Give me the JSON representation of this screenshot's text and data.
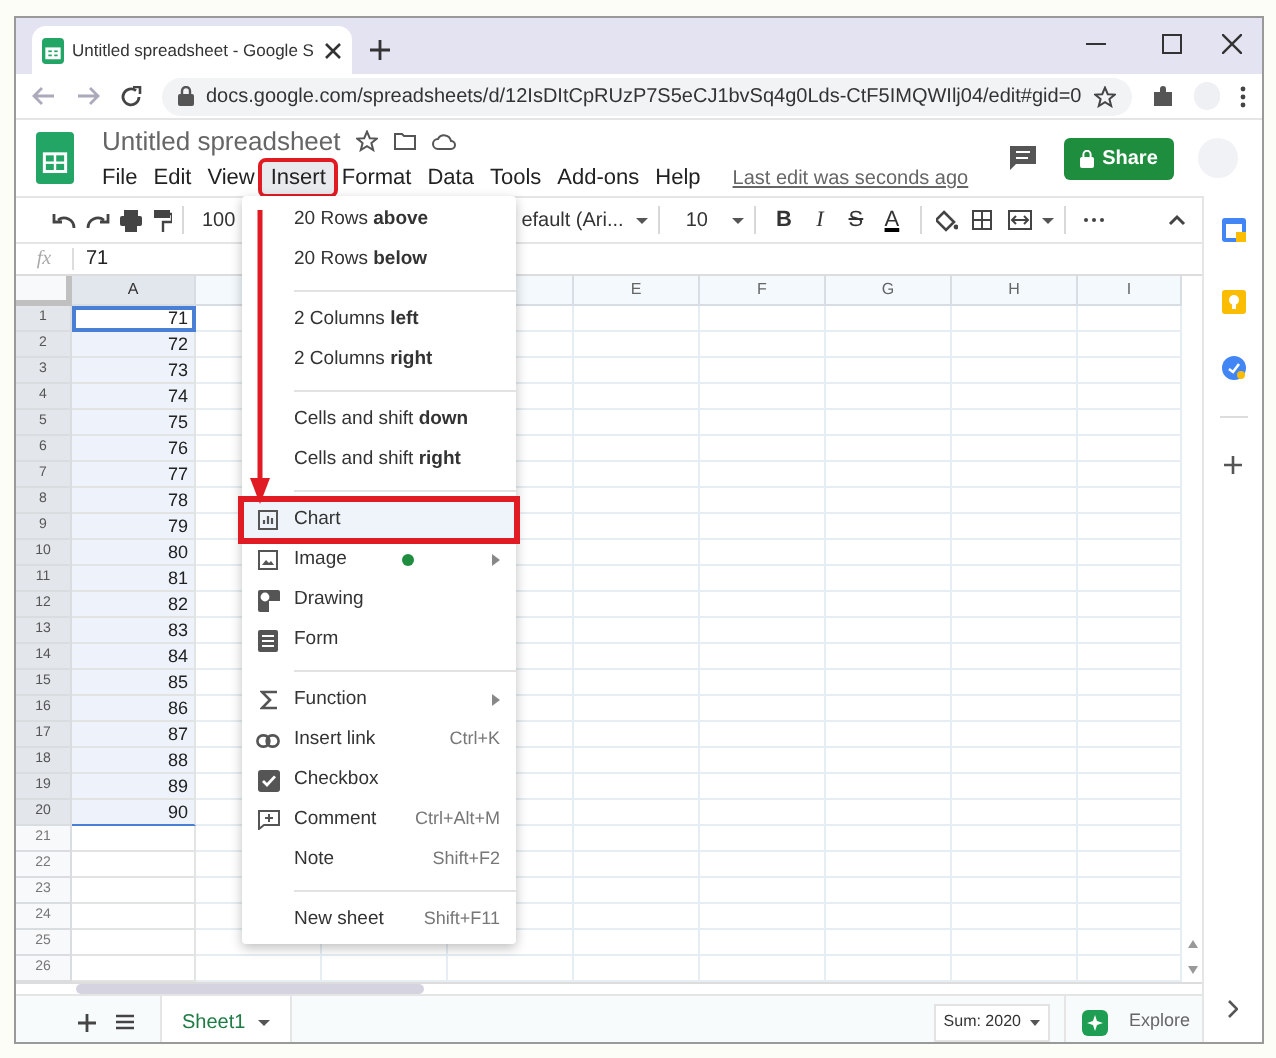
{
  "browser": {
    "tab_title": "Untitled spreadsheet - Google S",
    "url": "docs.google.com/spreadsheets/d/12IsDItCpRUzP7S5eCJ1bvSq4g0Lds-CtF5IMQWIlj04/edit#gid=0"
  },
  "doc": {
    "title": "Untitled spreadsheet",
    "last_edit": "Last edit was seconds ago",
    "share_label": "Share"
  },
  "menu_bar": [
    {
      "label": "File",
      "selected": false,
      "highlighted": false
    },
    {
      "label": "Edit",
      "selected": false,
      "highlighted": false
    },
    {
      "label": "View",
      "selected": false,
      "highlighted": false
    },
    {
      "label": "Insert",
      "selected": true,
      "highlighted": true
    },
    {
      "label": "Format",
      "selected": false,
      "highlighted": false
    },
    {
      "label": "Data",
      "selected": false,
      "highlighted": false
    },
    {
      "label": "Tools",
      "selected": false,
      "highlighted": false
    },
    {
      "label": "Add-ons",
      "selected": false,
      "highlighted": false
    },
    {
      "label": "Help",
      "selected": false,
      "highlighted": false
    }
  ],
  "toolbar": {
    "zoom": "100",
    "font": "efault (Ari...",
    "font_size": "10",
    "format_buttons": [
      "B",
      "I",
      "S",
      "A"
    ]
  },
  "formula_bar": {
    "fx": "fx",
    "value": "71"
  },
  "columns": [
    {
      "label": "A",
      "selected": true
    },
    {
      "label": "E",
      "selected": false
    },
    {
      "label": "F",
      "selected": false
    },
    {
      "label": "G",
      "selected": false
    },
    {
      "label": "H",
      "selected": false
    },
    {
      "label": "I",
      "selected": false
    }
  ],
  "rows": [
    {
      "label": "1",
      "value": "71",
      "selected": true,
      "active": true
    },
    {
      "label": "2",
      "value": "72",
      "selected": true,
      "active": false
    },
    {
      "label": "3",
      "value": "73",
      "selected": true,
      "active": false
    },
    {
      "label": "4",
      "value": "74",
      "selected": true,
      "active": false
    },
    {
      "label": "5",
      "value": "75",
      "selected": true,
      "active": false
    },
    {
      "label": "6",
      "value": "76",
      "selected": true,
      "active": false
    },
    {
      "label": "7",
      "value": "77",
      "selected": true,
      "active": false
    },
    {
      "label": "8",
      "value": "78",
      "selected": true,
      "active": false
    },
    {
      "label": "9",
      "value": "79",
      "selected": true,
      "active": false
    },
    {
      "label": "10",
      "value": "80",
      "selected": true,
      "active": false
    },
    {
      "label": "11",
      "value": "81",
      "selected": true,
      "active": false
    },
    {
      "label": "12",
      "value": "82",
      "selected": true,
      "active": false
    },
    {
      "label": "13",
      "value": "83",
      "selected": true,
      "active": false
    },
    {
      "label": "14",
      "value": "84",
      "selected": true,
      "active": false
    },
    {
      "label": "15",
      "value": "85",
      "selected": true,
      "active": false
    },
    {
      "label": "16",
      "value": "86",
      "selected": true,
      "active": false
    },
    {
      "label": "17",
      "value": "87",
      "selected": true,
      "active": false
    },
    {
      "label": "18",
      "value": "88",
      "selected": true,
      "active": false
    },
    {
      "label": "19",
      "value": "89",
      "selected": true,
      "active": false
    },
    {
      "label": "20",
      "value": "90",
      "selected": true,
      "active": false
    },
    {
      "label": "21",
      "selected": false,
      "active": false
    },
    {
      "label": "22",
      "selected": false,
      "active": false
    },
    {
      "label": "23",
      "selected": false,
      "active": false
    },
    {
      "label": "24",
      "selected": false,
      "active": false
    },
    {
      "label": "25",
      "selected": false,
      "active": false
    },
    {
      "label": "26",
      "selected": false,
      "active": false
    }
  ],
  "insert_menu": [
    {
      "kind": "text",
      "label": "20 Rows **above**",
      "highlighted": false,
      "submenu": false,
      "dot": false
    },
    {
      "kind": "text",
      "label": "20 Rows **below**",
      "highlighted": false,
      "submenu": false,
      "dot": false
    },
    {
      "kind": "divider"
    },
    {
      "kind": "text",
      "label": "2 Columns **left**",
      "highlighted": false,
      "submenu": false,
      "dot": false
    },
    {
      "kind": "text",
      "label": "2 Columns **right**",
      "highlighted": false,
      "submenu": false,
      "dot": false
    },
    {
      "kind": "divider"
    },
    {
      "kind": "text",
      "label": "Cells and shift **down**",
      "highlighted": false,
      "submenu": false,
      "dot": false
    },
    {
      "kind": "text",
      "label": "Cells and shift **right**",
      "highlighted": false,
      "submenu": false,
      "dot": false
    },
    {
      "kind": "divider"
    },
    {
      "kind": "chart",
      "label": "Chart",
      "highlighted": true,
      "submenu": false,
      "dot": false
    },
    {
      "kind": "image",
      "label": "Image",
      "highlighted": false,
      "submenu": true,
      "dot": true
    },
    {
      "kind": "drawing",
      "label": "Drawing",
      "highlighted": false,
      "submenu": false,
      "dot": false
    },
    {
      "kind": "form",
      "label": "Form",
      "highlighted": false,
      "submenu": false,
      "dot": false
    },
    {
      "kind": "divider"
    },
    {
      "kind": "function",
      "label": "Function",
      "highlighted": false,
      "submenu": true,
      "dot": false
    },
    {
      "kind": "link",
      "label": "Insert link",
      "shortcut": "Ctrl+K",
      "highlighted": false,
      "submenu": false,
      "dot": false
    },
    {
      "kind": "checkbox",
      "label": "Checkbox",
      "highlighted": false,
      "submenu": false,
      "dot": false
    },
    {
      "kind": "comment",
      "label": "Comment",
      "shortcut": "Ctrl+Alt+M",
      "highlighted": false,
      "submenu": false,
      "dot": false
    },
    {
      "kind": "text",
      "label": "Note",
      "shortcut": "Shift+F2",
      "highlighted": false,
      "submenu": false,
      "dot": false
    },
    {
      "kind": "divider"
    },
    {
      "kind": "text",
      "label": "New sheet",
      "shortcut": "Shift+F11",
      "highlighted": false,
      "submenu": false,
      "dot": false
    }
  ],
  "sheet_tabs": [
    {
      "label": "Sheet1",
      "selected": true
    }
  ],
  "sum": "Sum: 2020",
  "explore_label": "Explore"
}
